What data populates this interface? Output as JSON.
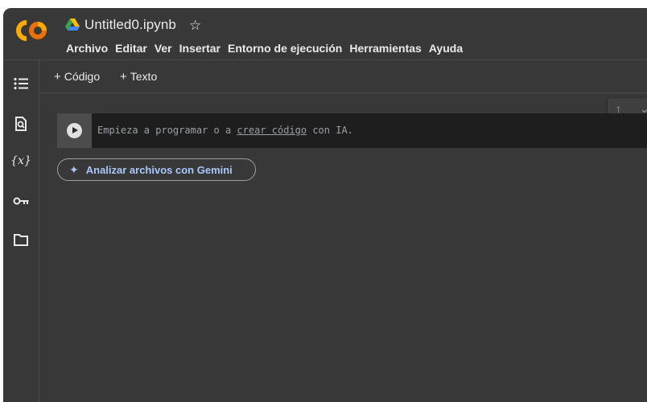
{
  "header": {
    "notebook_title": "Untitled0.ipynb",
    "menu": [
      "Archivo",
      "Editar",
      "Ver",
      "Insertar",
      "Entorno de ejecución",
      "Herramientas",
      "Ayuda"
    ]
  },
  "toolbar": {
    "add_code": "Código",
    "add_text": "Texto"
  },
  "cell": {
    "placeholder_before": "Empieza a programar o a ",
    "placeholder_link": "crear código",
    "placeholder_after": " con IA."
  },
  "gemini": {
    "label": "Analizar archivos con Gemini"
  },
  "sidebar": {
    "variables_label": "{x}"
  },
  "colors": {
    "background": "#383838",
    "cell_background": "#1e1e1e",
    "accent_gemini": "#a8c7fa",
    "logo_orange": "#f9ab00",
    "logo_dark_orange": "#e8710a"
  }
}
